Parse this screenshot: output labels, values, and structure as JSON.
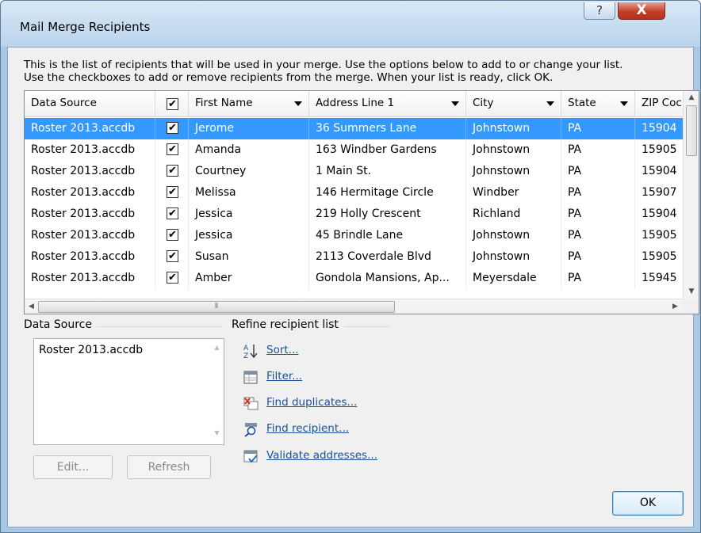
{
  "window": {
    "title": "Mail Merge Recipients",
    "help_glyph": "?",
    "close_glyph": "X"
  },
  "intro": {
    "line1": "This is the list of recipients that will be used in your merge.  Use the options below to add to or change your list.",
    "line2": "Use the checkboxes to add or remove recipients from the merge.  When your list is ready, click OK."
  },
  "grid": {
    "columns": [
      "Data Source",
      "",
      "First Name",
      "Address Line 1",
      "City",
      "State",
      "ZIP Coc"
    ],
    "header_checked": true,
    "rows": [
      {
        "source": "Roster 2013.accdb",
        "checked": true,
        "first": "Jerome",
        "address": "36 Summers Lane",
        "city": "Johnstown",
        "state": "PA",
        "zip": "15904",
        "selected": true
      },
      {
        "source": "Roster 2013.accdb",
        "checked": true,
        "first": "Amanda",
        "address": "163 Windber Gardens",
        "city": "Johnstown",
        "state": "PA",
        "zip": "15905"
      },
      {
        "source": "Roster 2013.accdb",
        "checked": true,
        "first": "Courtney",
        "address": "1 Main St.",
        "city": "Johnstown",
        "state": "PA",
        "zip": "15904"
      },
      {
        "source": "Roster 2013.accdb",
        "checked": true,
        "first": "Melissa",
        "address": "146 Hermitage Circle",
        "city": "Windber",
        "state": "PA",
        "zip": "15907"
      },
      {
        "source": "Roster 2013.accdb",
        "checked": true,
        "first": "Jessica",
        "address": "219 Holly Crescent",
        "city": "Richland",
        "state": "PA",
        "zip": "15904"
      },
      {
        "source": "Roster 2013.accdb",
        "checked": true,
        "first": "Jessica",
        "address": "45 Brindle Lane",
        "city": "Johnstown",
        "state": "PA",
        "zip": "15905"
      },
      {
        "source": "Roster 2013.accdb",
        "checked": true,
        "first": "Susan",
        "address": "2113 Coverdale Blvd",
        "city": "Johnstown",
        "state": "PA",
        "zip": "15905"
      },
      {
        "source": "Roster 2013.accdb",
        "checked": true,
        "first": "Amber",
        "address": "Gondola Mansions, Ap...",
        "city": "Meyersdale",
        "state": "PA",
        "zip": "15945"
      }
    ]
  },
  "data_source": {
    "label": "Data Source",
    "items": [
      "Roster 2013.accdb"
    ],
    "edit_label": "Edit...",
    "refresh_label": "Refresh"
  },
  "refine": {
    "label": "Refine recipient list",
    "links": [
      {
        "label": "Sort...",
        "icon": "sort-icon"
      },
      {
        "label": "Filter...",
        "icon": "filter-icon"
      },
      {
        "label": "Find duplicates...",
        "icon": "find-duplicates-icon"
      },
      {
        "label": "Find recipient...",
        "icon": "find-recipient-icon"
      },
      {
        "label": "Validate addresses...",
        "icon": "validate-addresses-icon"
      }
    ]
  },
  "ok_label": "OK",
  "colors": {
    "selection": "#3399ff",
    "link": "#1a4f9c",
    "close_button": "#c4402a"
  }
}
